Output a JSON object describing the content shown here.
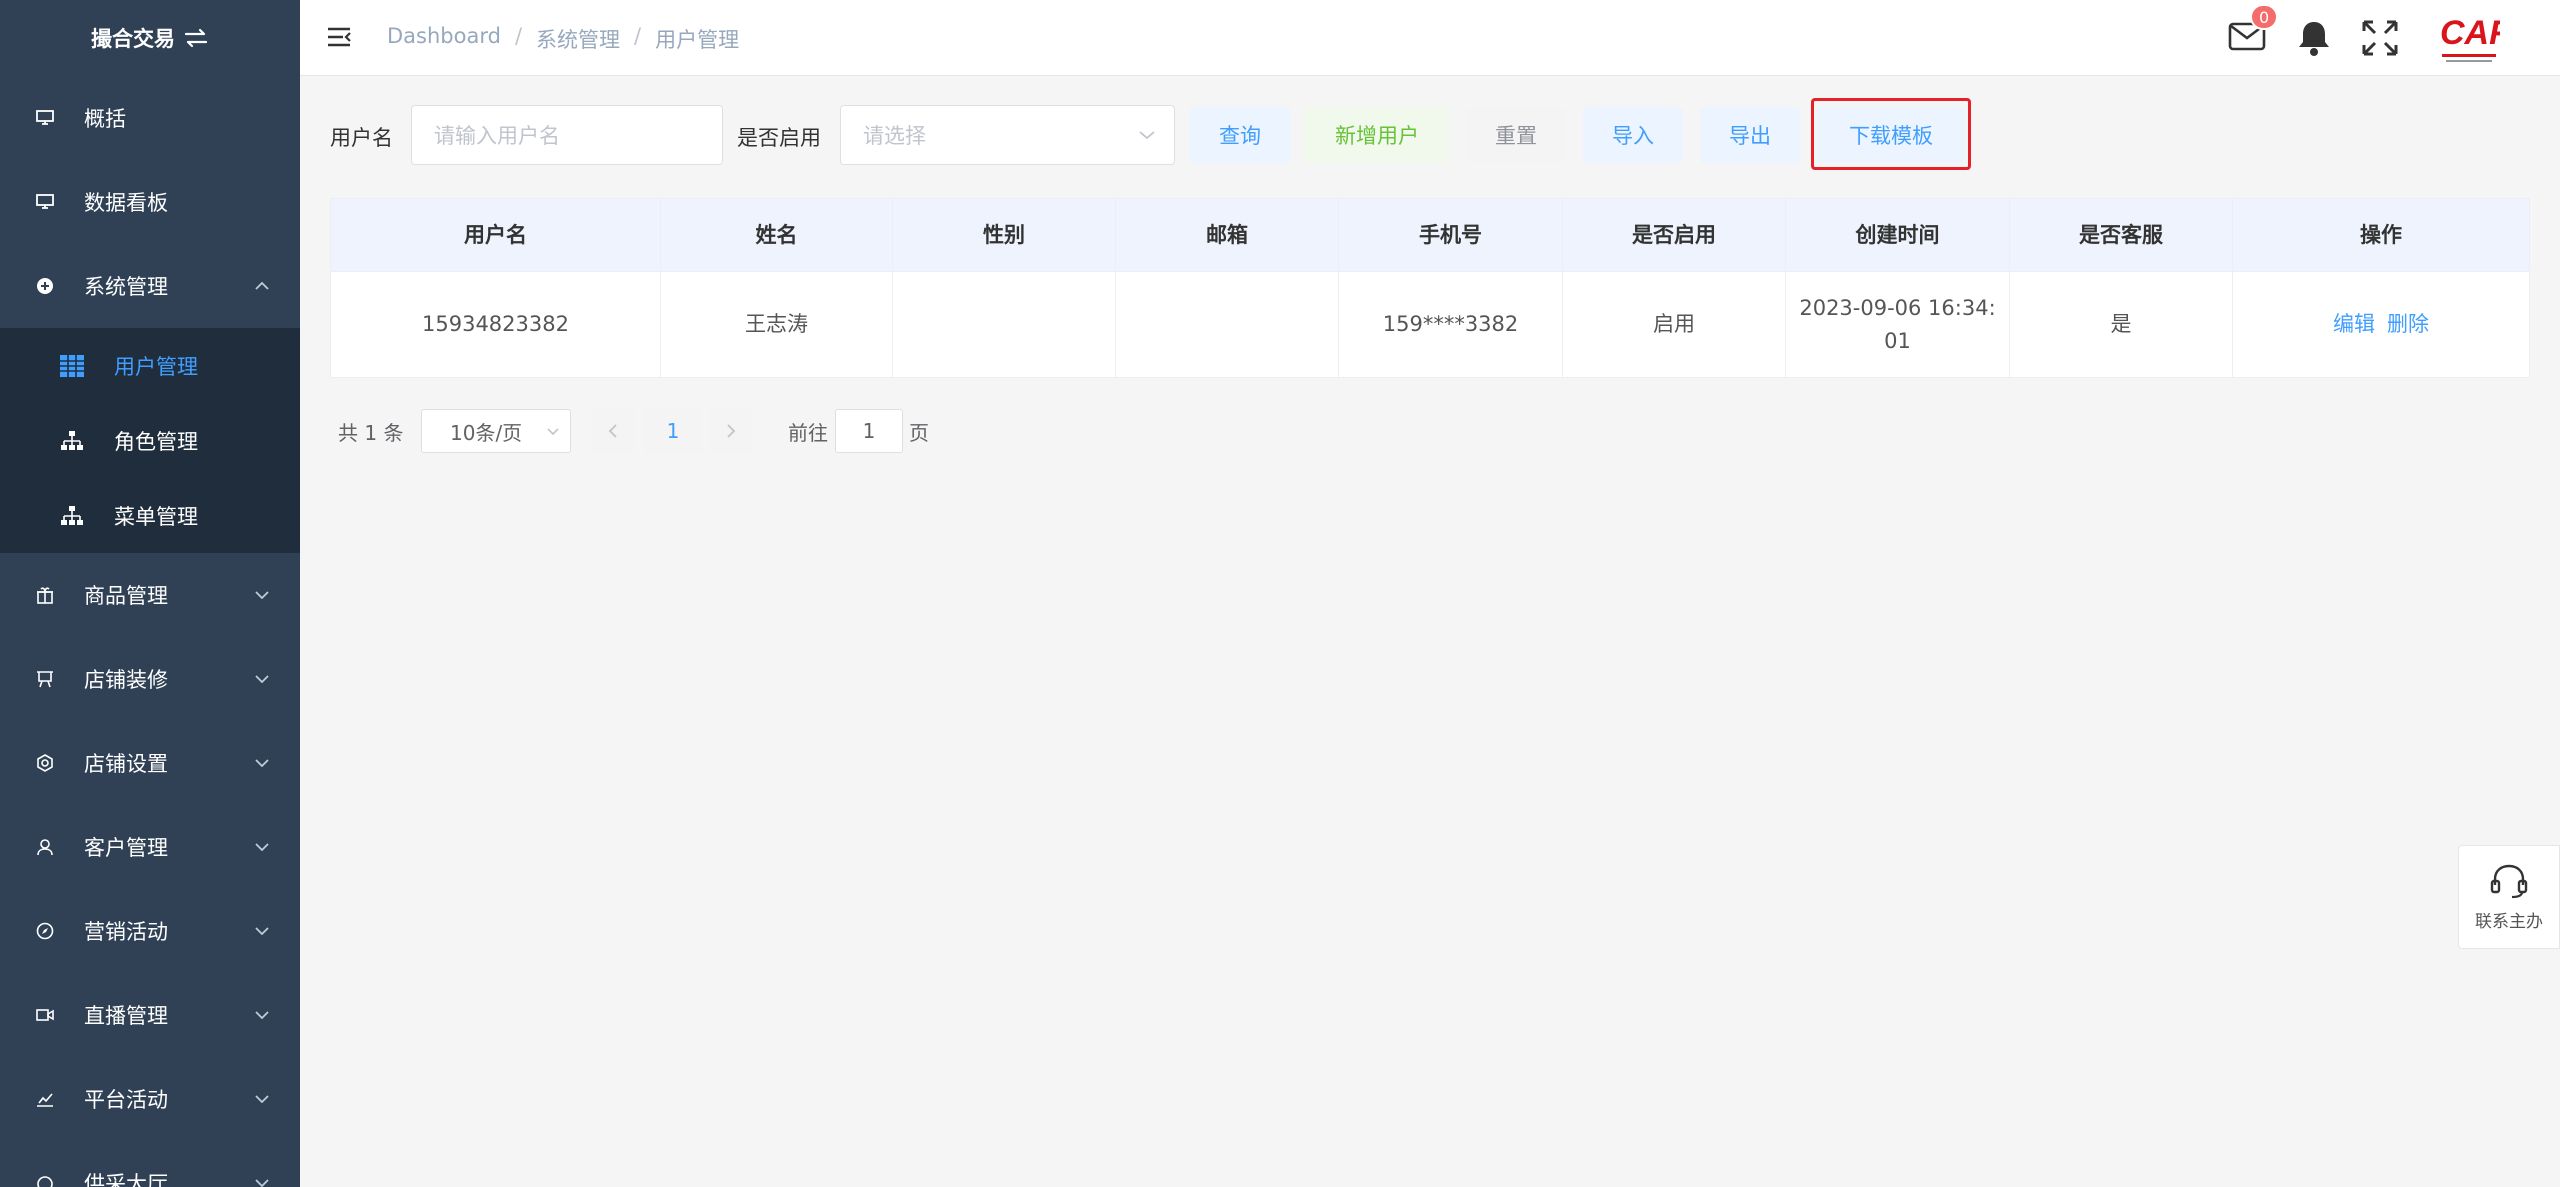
{
  "brand": {
    "title": "撮合交易"
  },
  "sidebar": {
    "items": [
      {
        "label": "概括",
        "icon": "monitor-icon"
      },
      {
        "label": "数据看板",
        "icon": "monitor-icon"
      },
      {
        "label": "系统管理",
        "icon": "plus-circle-icon",
        "expanded": true
      },
      {
        "label": "商品管理",
        "icon": "gift-icon"
      },
      {
        "label": "店铺装修",
        "icon": "easel-icon"
      },
      {
        "label": "店铺设置",
        "icon": "gear-icon"
      },
      {
        "label": "客户管理",
        "icon": "user-icon"
      },
      {
        "label": "营销活动",
        "icon": "compass-icon"
      },
      {
        "label": "直播管理",
        "icon": "camera-icon"
      },
      {
        "label": "平台活动",
        "icon": "chart-icon"
      },
      {
        "label": "供采大厅",
        "icon": "hall-icon"
      }
    ],
    "submenu": [
      {
        "label": "用户管理",
        "icon": "grid-table-icon",
        "active": true
      },
      {
        "label": "角色管理",
        "icon": "org-tree-icon"
      },
      {
        "label": "菜单管理",
        "icon": "org-tree-icon"
      }
    ]
  },
  "header": {
    "breadcrumb": [
      "Dashboard",
      "系统管理",
      "用户管理"
    ],
    "mail_badge": "0",
    "logo_text": "CAF"
  },
  "filters": {
    "username_label": "用户名",
    "username_placeholder": "请输入用户名",
    "enabled_label": "是否启用",
    "enabled_placeholder": "请选择"
  },
  "buttons": {
    "query": "查询",
    "add_user": "新增用户",
    "reset": "重置",
    "import": "导入",
    "export": "导出",
    "download_template": "下载模板"
  },
  "table": {
    "columns": [
      "用户名",
      "姓名",
      "性别",
      "邮箱",
      "手机号",
      "是否启用",
      "创建时间",
      "是否客服",
      "操作"
    ],
    "rows": [
      {
        "username": "15934823382",
        "name": "王志涛",
        "gender": "",
        "email": "",
        "phone": "159****3382",
        "enabled": "启用",
        "created": "2023-09-06 16:34:01",
        "is_service": "是",
        "edit": "编辑",
        "delete": "删除"
      }
    ]
  },
  "pagination": {
    "total": "共 1 条",
    "page_size": "10条/页",
    "current": "1",
    "goto_label": "前往",
    "goto_value": "1",
    "page_unit": "页"
  },
  "support": {
    "label": "联系主办"
  },
  "colors": {
    "sidebar": "#304156",
    "submenu": "#1f2d3d",
    "accent": "#409eff",
    "highlight": "#e4202a"
  }
}
